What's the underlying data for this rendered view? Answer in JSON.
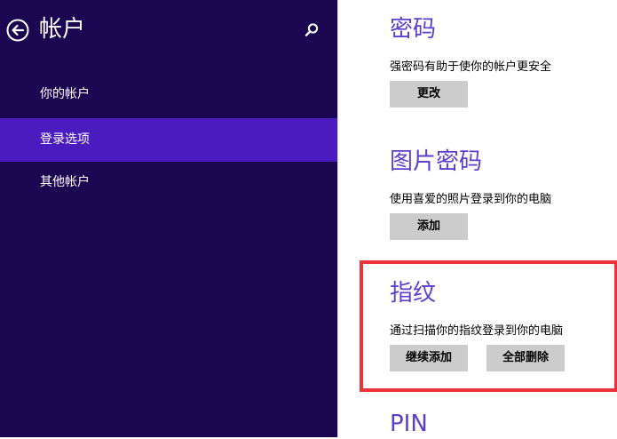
{
  "sidebar": {
    "title": "帐户",
    "items": [
      {
        "label": "你的帐户",
        "active": false
      },
      {
        "label": "登录选项",
        "active": true
      },
      {
        "label": "其他帐户",
        "active": false
      }
    ]
  },
  "icons": {
    "back": "back-arrow-circle-icon",
    "search": "search-icon"
  },
  "sections": {
    "password": {
      "title": "密码",
      "description": "强密码有助于使你的帐户更安全",
      "change_label": "更改"
    },
    "picture_password": {
      "title": "图片密码",
      "description": "使用喜爱的照片登录到你的电脑",
      "add_label": "添加"
    },
    "fingerprint": {
      "title": "指纹",
      "description": "通过扫描你的指纹登录到你的电脑",
      "continue_add_label": "继续添加",
      "delete_all_label": "全部删除"
    },
    "pin": {
      "title": "PIN"
    }
  },
  "colors": {
    "sidebar_bg": "#1b0651",
    "active_item_bg": "#4a1cc0",
    "section_title": "#5a3fd0",
    "button_bg": "#cccccc",
    "highlight_border": "#ee3338"
  }
}
